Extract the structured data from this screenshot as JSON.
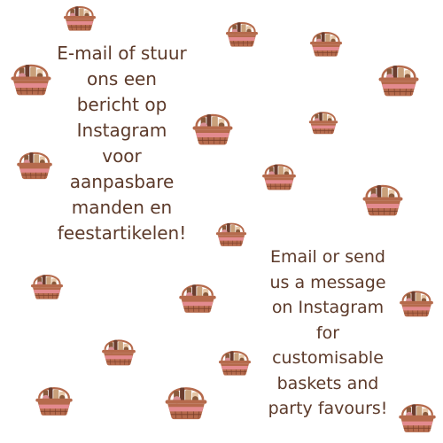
{
  "messages": {
    "dutch": "E-mail of stuur\nons een\nbericht op\nInstagram\nvoor\naanpasbare\nmanden en\nfeestartikelen!",
    "english": "Email or send\nus a message\non Instagram\nfor\ncustomisable\nbaskets and\nparty favours!"
  },
  "colors": {
    "text": "#5c3a2a",
    "basket": "#b56a4c",
    "basket_dark": "#7a3f2a",
    "band": "#e38a8e",
    "goods": [
      "#8a5a3c",
      "#c9a07a",
      "#e6c7a8",
      "#d88f94",
      "#6b3d2e"
    ]
  },
  "icons": {
    "decoration": "gift-basket-icon"
  }
}
